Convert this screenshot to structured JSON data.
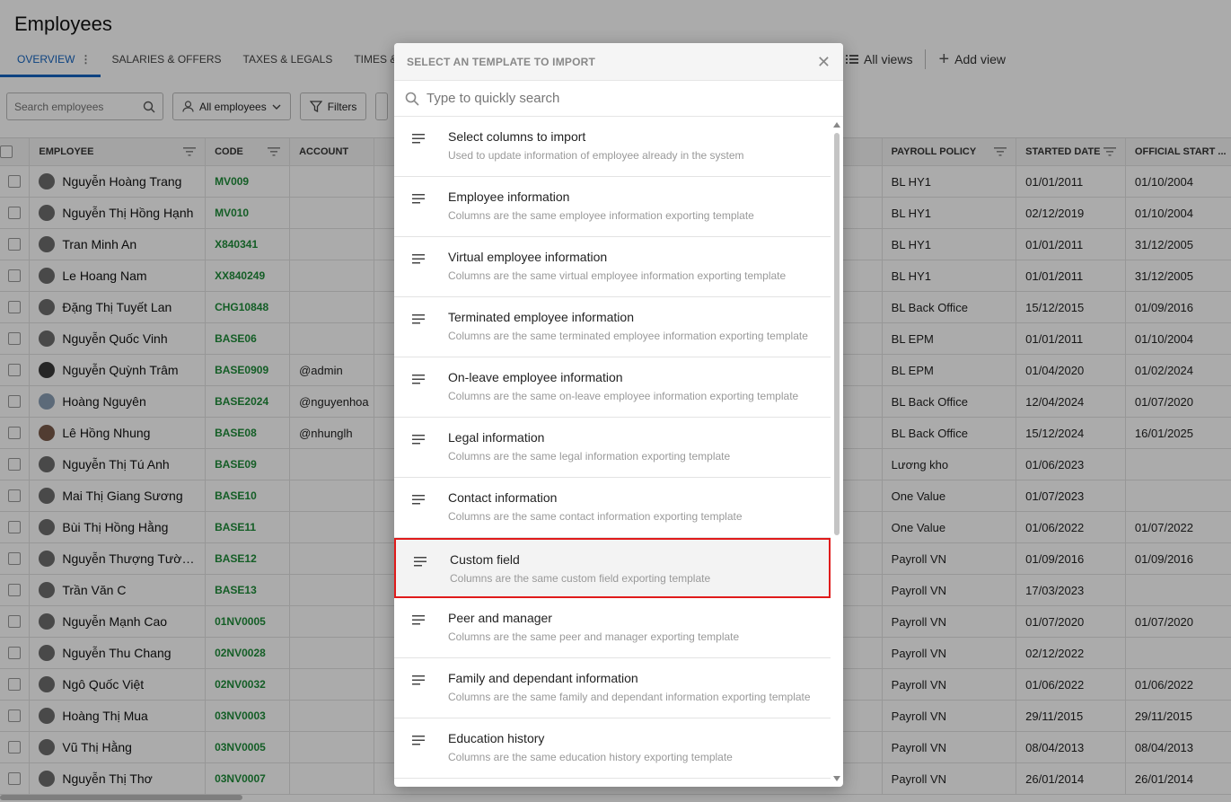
{
  "page": {
    "title": "Employees",
    "tabs": [
      {
        "label": "OVERVIEW"
      },
      {
        "label": "SALARIES & OFFERS"
      },
      {
        "label": "TAXES & LEGALS"
      },
      {
        "label": "TIMES & AT"
      }
    ],
    "all_views_label": "All views",
    "add_view_label": "Add view"
  },
  "toolbar": {
    "search_placeholder": "Search employees",
    "employees_filter_label": "All employees",
    "filters_label": "Filters"
  },
  "table": {
    "headers": {
      "employee": "EMPLOYEE",
      "code": "CODE",
      "account": "ACCOUNT",
      "payroll_policy": "PAYROLL POLICY",
      "started_date": "STARTED DATE",
      "official_start": "OFFICIAL START ..."
    },
    "rows": [
      {
        "name": "Nguyễn Hoàng Trang",
        "code": "MV009",
        "account": "",
        "policy": "BL HY1",
        "started": "01/01/2011",
        "official": "01/10/2004"
      },
      {
        "name": "Nguyễn Thị Hồng Hạnh",
        "code": "MV010",
        "account": "",
        "policy": "BL HY1",
        "started": "02/12/2019",
        "official": "01/10/2004"
      },
      {
        "name": "Tran Minh An",
        "code": "X840341",
        "account": "",
        "policy": "BL HY1",
        "started": "01/01/2011",
        "official": "31/12/2005"
      },
      {
        "name": "Le Hoang Nam",
        "code": "XX840249",
        "account": "",
        "policy": "BL HY1",
        "started": "01/01/2011",
        "official": "31/12/2005"
      },
      {
        "name": "Đặng Thị Tuyết Lan",
        "code": "CHG10848",
        "account": "",
        "policy": "BL Back Office",
        "started": "15/12/2015",
        "official": "01/09/2016"
      },
      {
        "name": "Nguyễn Quốc Vinh",
        "code": "BASE06",
        "account": "",
        "policy": "BL EPM",
        "started": "01/01/2011",
        "official": "01/10/2004"
      },
      {
        "name": "Nguyễn Quỳnh Trâm",
        "code": "BASE0909",
        "account": "@admin",
        "policy": "BL EPM",
        "started": "01/04/2020",
        "official": "01/02/2024"
      },
      {
        "name": "Hoàng Nguyên",
        "code": "BASE2024",
        "account": "@nguyenhoa",
        "policy": "BL Back Office",
        "started": "12/04/2024",
        "official": "01/07/2020"
      },
      {
        "name": "Lê Hồng Nhung",
        "code": "BASE08",
        "account": "@nhunglh",
        "policy": "BL Back Office",
        "started": "15/12/2024",
        "official": "16/01/2025"
      },
      {
        "name": "Nguyễn Thị Tú Anh",
        "code": "BASE09",
        "account": "",
        "policy": "Lương kho",
        "started": "01/06/2023",
        "official": ""
      },
      {
        "name": "Mai Thị Giang Sương",
        "code": "BASE10",
        "account": "",
        "policy": "One Value",
        "started": "01/07/2023",
        "official": ""
      },
      {
        "name": "Bùi Thị Hồng Hằng",
        "code": "BASE11",
        "account": "",
        "policy": "One Value",
        "started": "01/06/2022",
        "official": "01/07/2022"
      },
      {
        "name": "Nguyễn Thượng Tường ...",
        "code": "BASE12",
        "account": "",
        "policy": "Payroll VN",
        "started": "01/09/2016",
        "official": "01/09/2016"
      },
      {
        "name": "Trần Văn C",
        "code": "BASE13",
        "account": "",
        "policy": "Payroll VN",
        "started": "17/03/2023",
        "official": ""
      },
      {
        "name": "Nguyễn Mạnh Cao",
        "code": "01NV0005",
        "account": "",
        "policy": "Payroll VN",
        "started": "01/07/2020",
        "official": "01/07/2020"
      },
      {
        "name": "Nguyễn Thu Chang",
        "code": "02NV0028",
        "account": "",
        "policy": "Payroll VN",
        "started": "02/12/2022",
        "official": ""
      },
      {
        "name": "Ngô Quốc Việt",
        "code": "02NV0032",
        "account": "",
        "policy": "Payroll VN",
        "started": "01/06/2022",
        "official": "01/06/2022"
      },
      {
        "name": "Hoàng Thị Mua",
        "code": "03NV0003",
        "account": "",
        "policy": "Payroll VN",
        "started": "29/11/2015",
        "official": "29/11/2015"
      },
      {
        "name": "Vũ Thị Hằng",
        "code": "03NV0005",
        "account": "",
        "policy": "Payroll VN",
        "started": "08/04/2013",
        "official": "08/04/2013"
      },
      {
        "name": "Nguyễn Thị Thơ",
        "code": "03NV0007",
        "account": "",
        "policy": "Payroll VN",
        "started": "26/01/2014",
        "official": "26/01/2014"
      }
    ]
  },
  "modal": {
    "title": "SELECT AN TEMPLATE TO IMPORT",
    "search_placeholder": "Type to quickly search",
    "highlight_color": "#e01b1b",
    "items": [
      {
        "title": "Select columns to import",
        "desc": "Used to update information of employee already in the system"
      },
      {
        "title": "Employee information",
        "desc": "Columns are the same employee information exporting template"
      },
      {
        "title": "Virtual employee information",
        "desc": "Columns are the same virtual employee information exporting template"
      },
      {
        "title": "Terminated employee information",
        "desc": "Columns are the same terminated employee information exporting template"
      },
      {
        "title": "On-leave employee information",
        "desc": "Columns are the same on-leave employee information exporting template"
      },
      {
        "title": "Legal information",
        "desc": "Columns are the same legal information exporting template"
      },
      {
        "title": "Contact information",
        "desc": "Columns are the same contact information exporting template"
      },
      {
        "title": "Custom field",
        "desc": "Columns are the same custom field exporting template"
      },
      {
        "title": "Peer and manager",
        "desc": "Columns are the same peer and manager exporting template"
      },
      {
        "title": "Family and dependant information",
        "desc": "Columns are the same family and dependant information exporting template"
      },
      {
        "title": "Education history",
        "desc": "Columns are the same education history exporting template"
      }
    ]
  }
}
